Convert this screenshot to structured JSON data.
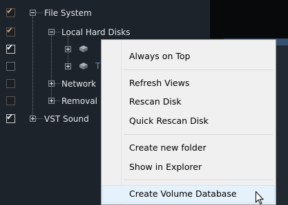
{
  "tree": {
    "file_system": "File System",
    "local_hard_disks": "Local Hard Disks",
    "network": "Network",
    "removable": "Removal",
    "vst_sound": "VST Sound",
    "checkmark": "✔"
  },
  "context_menu": {
    "items": [
      "Always on Top",
      "Refresh Views",
      "Rescan Disk",
      "Quick Rescan Disk",
      "Create new folder",
      "Show in Explorer",
      "Create Volume Database"
    ],
    "hovered_item": "Create Volume Database"
  },
  "colors": {
    "panel_background": "#1d232b",
    "menu_background": "#f0f0f0",
    "menu_hover": "#e5f1fb",
    "accent_strip": "#34506f"
  },
  "icons": [
    "checkbox-icon",
    "expander-minus-icon",
    "expander-plus-icon",
    "disk-icon",
    "mouse-pointer-icon"
  ]
}
